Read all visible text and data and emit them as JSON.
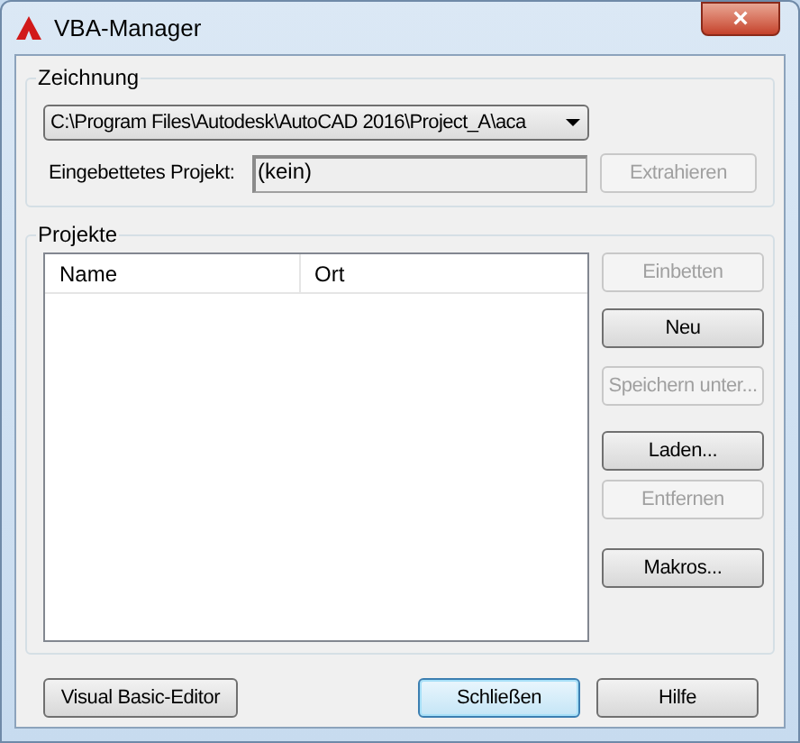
{
  "window": {
    "title": "VBA-Manager",
    "close": "×"
  },
  "drawing_group": {
    "title": "Zeichnung",
    "drawing": "C:\\Program Files\\Autodesk\\AutoCAD 2016\\Project_A\\aca",
    "embedded_label": "Eingebettetes Projekt:",
    "embedded_value": "(kein)",
    "extract_button": {
      "label": "Extrahieren",
      "disabled": true
    }
  },
  "projects_group": {
    "title": "Projekte",
    "columns": [
      "Name",
      "Ort"
    ],
    "buttons": [
      {
        "label": "Einbetten",
        "disabled": true
      },
      {
        "label": "Neu",
        "disabled": false
      },
      {
        "label": "Speichern unter...",
        "disabled": true
      },
      {
        "label": "Laden...",
        "disabled": false
      },
      {
        "label": "Entfernen",
        "disabled": true
      },
      {
        "label": "Makros...",
        "disabled": false
      }
    ]
  },
  "footer_buttons": [
    {
      "label": "Visual Basic-Editor",
      "default": false
    },
    {
      "label": "Schließen",
      "default": true
    },
    {
      "label": "Hilfe",
      "default": false
    }
  ]
}
